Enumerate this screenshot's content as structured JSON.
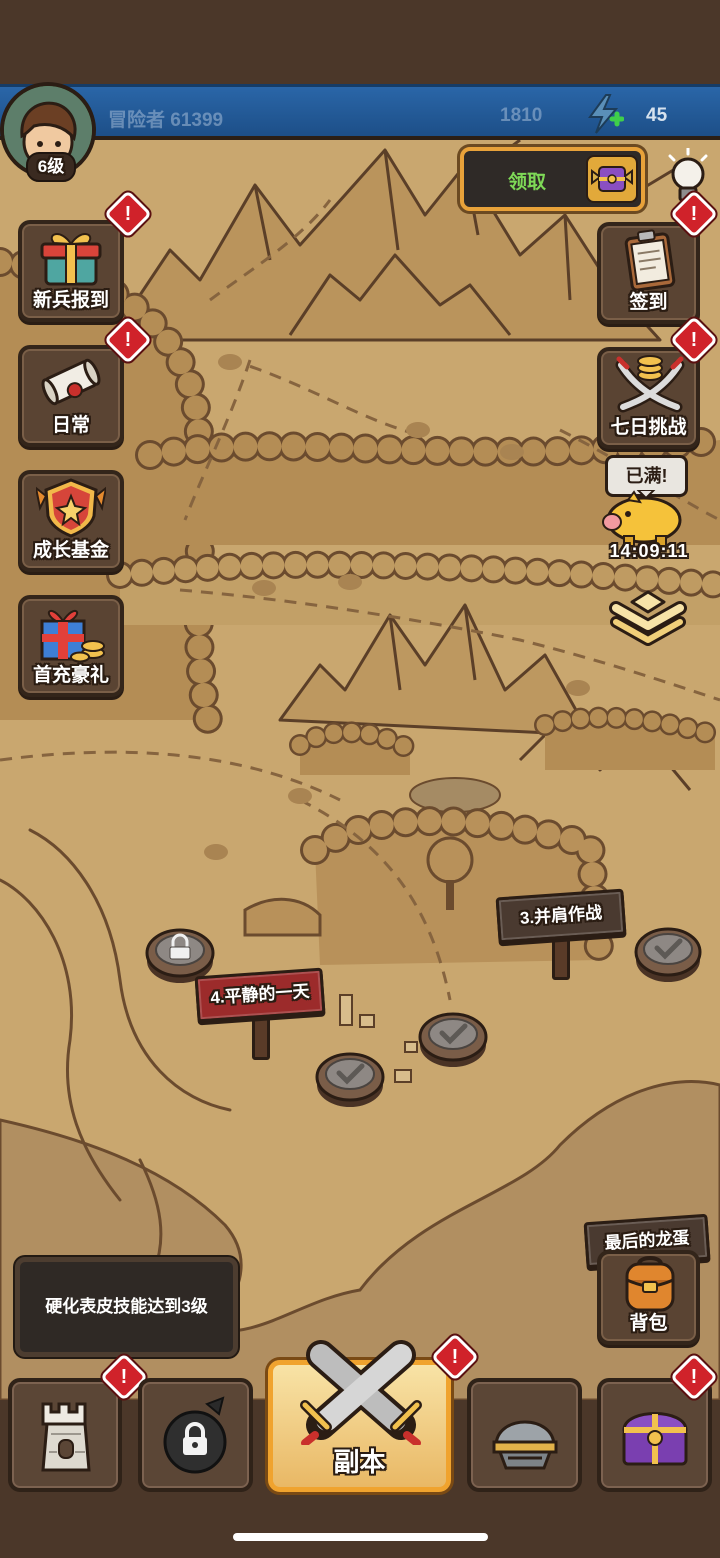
{
  "header": {
    "player_name": "冒险者 61399",
    "level": "6级",
    "coins": "1810",
    "energy": "45",
    "avatar_icon": "hero-portrait-icon",
    "energy_icon": "lightning-plus-icon"
  },
  "claim_button": {
    "label": "领取",
    "icon": "winged-chest-icon"
  },
  "hint_icon": "light-bulb-icon",
  "left_menu": [
    {
      "label": "新兵报到",
      "icon": "gift-box-icon",
      "badge": "!"
    },
    {
      "label": "日常",
      "icon": "scroll-icon",
      "badge": "!"
    },
    {
      "label": "成长基金",
      "icon": "shield-star-icon"
    },
    {
      "label": "首充豪礼",
      "icon": "gift-pile-icon"
    }
  ],
  "right_menu": [
    {
      "label": "签到",
      "icon": "clipboard-icon",
      "badge": "!"
    },
    {
      "label": "七日挑战",
      "icon": "crossed-swords-coins-icon",
      "badge": "!"
    }
  ],
  "piggy_bank": {
    "bubble": "已满!",
    "timer": "14:09:11",
    "icon": "piggy-bank-icon"
  },
  "expand_icon": "double-chevron-down-icon",
  "map": {
    "stages": [
      {
        "label": "3.并肩作战"
      },
      {
        "label": "4.平静的一天"
      },
      {
        "label": "最后的龙蛋"
      }
    ],
    "nodes": [
      {
        "icon": "lock-icon"
      },
      {
        "icon": "checkmark-icon"
      },
      {
        "icon": "checkmark-icon"
      },
      {
        "icon": "checkmark-icon"
      }
    ]
  },
  "quest": {
    "text": "硬化表皮技能达到3级"
  },
  "backpack": {
    "label": "背包",
    "icon": "backpack-icon"
  },
  "bottom_nav": [
    {
      "icon": "tower-icon",
      "badge": "!"
    },
    {
      "icon": "locked-sack-icon"
    },
    {
      "label": "副本",
      "icon": "crossed-swords-icon",
      "active": true,
      "badge": "!"
    },
    {
      "icon": "helmet-icon"
    },
    {
      "icon": "treasure-chest-icon",
      "badge": "!"
    }
  ],
  "colors": {
    "header_blue": "#2a66a8",
    "accent_orange": "#e8a23a",
    "claim_green": "#7ed957",
    "badge_red": "#d0222a",
    "sign_red": "#9c2b2b",
    "parchment": "#c9a76f"
  }
}
